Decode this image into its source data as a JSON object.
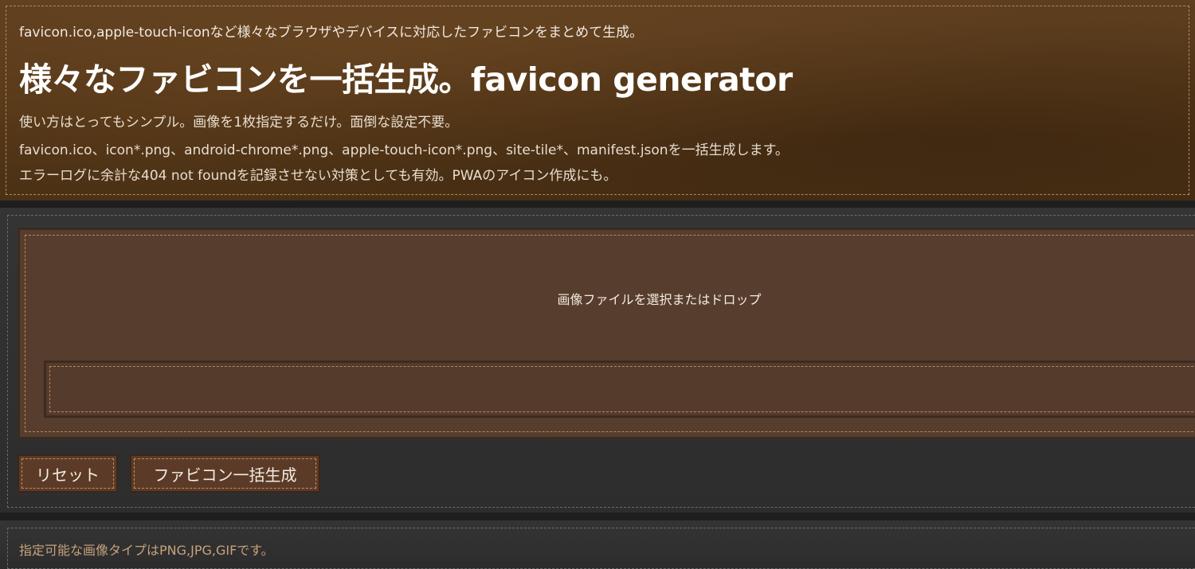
{
  "header": {
    "tagline": "favicon.ico,apple-touch-iconなど様々なブラウザやデバイスに対応したファビコンをまとめて生成。",
    "title": "様々なファビコンを一括生成。favicon generator",
    "description_lines": [
      "使い方はとってもシンプル。画像を1枚指定するだけ。面倒な設定不要。",
      "favicon.ico、icon*.png、android-chrome*.png、apple-touch-icon*.png、site-tile*、manifest.jsonを一括生成します。",
      "エラーログに余計な404 not foundを記録させない対策としても有効。PWAのアイコン作成にも。"
    ]
  },
  "uploader": {
    "dropzone_label": "画像ファイルを選択またはドロップ",
    "file_value": ""
  },
  "actions": {
    "reset_label": "リセット",
    "generate_label": "ファビコン一括生成"
  },
  "info": {
    "supported_types_text": "指定可能な画像タイプはPNG,JPG,GIFです。"
  },
  "colors": {
    "header_leather": "#5a3b1c",
    "panel_dark": "#2e2e2e",
    "dropzone_brown": "#573d2d",
    "stitch": "#b88a5c",
    "info_text": "#c7a27c"
  }
}
